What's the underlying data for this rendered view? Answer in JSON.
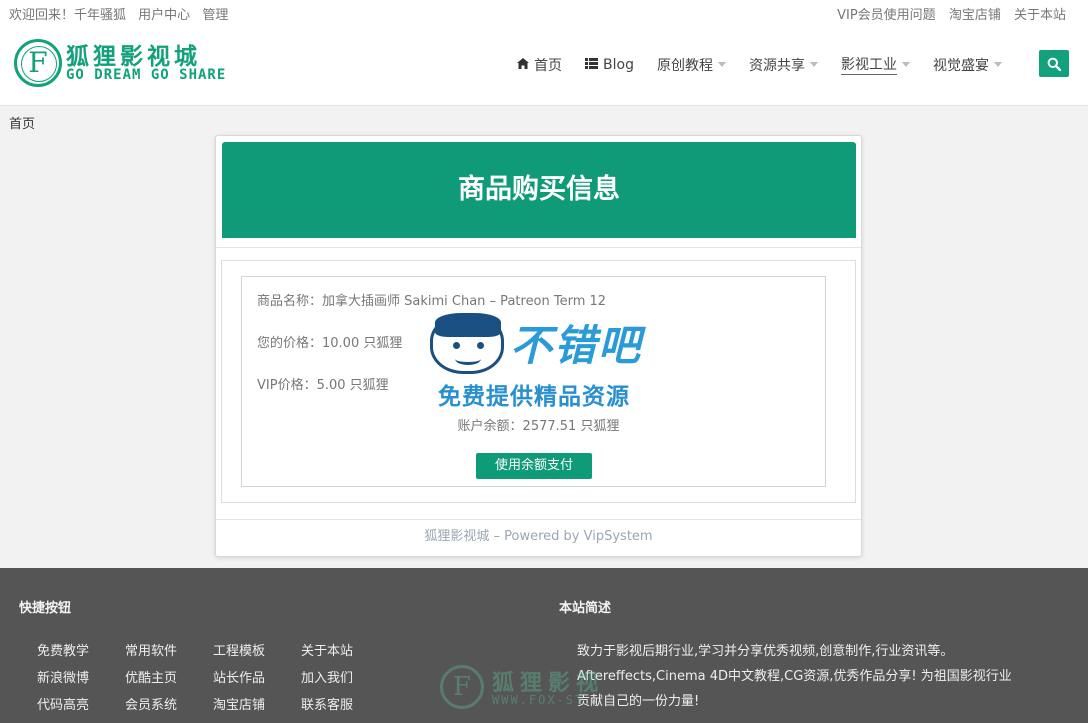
{
  "topbar": {
    "welcome": "欢迎回来！千年骚狐",
    "user_center": "用户中心",
    "admin": "管理",
    "vip_help": "VIP会员使用问题",
    "taobao": "淘宝店铺",
    "about": "关于本站"
  },
  "logo": {
    "letter": "F",
    "title": "狐狸影视城",
    "subtitle": "GO DREAM GO SHARE"
  },
  "nav": {
    "items": [
      {
        "label": "首页",
        "icon": "home-icon",
        "has_caret": false
      },
      {
        "label": "Blog",
        "icon": "list-icon",
        "has_caret": false
      },
      {
        "label": "原创教程",
        "icon": "",
        "has_caret": true
      },
      {
        "label": "资源共享",
        "icon": "",
        "has_caret": true
      },
      {
        "label": "影视工业",
        "icon": "",
        "has_caret": true
      },
      {
        "label": "视觉盛宴",
        "icon": "",
        "has_caret": true
      }
    ],
    "search_icon": "search-icon"
  },
  "breadcrumb": "首页",
  "card": {
    "title": "商品购买信息",
    "product_line": "商品名称：加拿大插画师 Sakimi Chan – Patreon Term 12",
    "price_line": "您的价格：10.00 只狐狸",
    "vip_line": "VIP价格：5.00 只狐狸",
    "balance_line": "账户余额：2577.51 只狐狸",
    "pay_button": "使用余额支付",
    "footer": "狐狸影视城 – Powered by VipSystem"
  },
  "watermark": {
    "text1": "不错吧",
    "text2": "免费提供精品资源"
  },
  "footer": {
    "links_title": "快捷按钮",
    "links": [
      "免费教学",
      "常用软件",
      "工程模板",
      "关于本站",
      "新浪微博",
      "优酷主页",
      "站长作品",
      "加入我们",
      "代码高亮",
      "会员系统",
      "淘宝店铺",
      "联系客服"
    ],
    "about_title": "本站简述",
    "about_lines": [
      "致力于影视后期行业,学习并分享优秀视频,创意制作,行业资讯等。",
      "Aftereffects,Cinema 4D中文教程,CG资源,优秀作品分享! 为祖国影视行业",
      "贡献自己的一份力量!"
    ],
    "logo_letter": "F",
    "logo_title": "狐狸影视",
    "logo_url": "WWW.FOX-ST"
  },
  "colors": {
    "brand": "#12a17a",
    "header_green": "#0f9a78",
    "footer_bg": "#555555"
  }
}
